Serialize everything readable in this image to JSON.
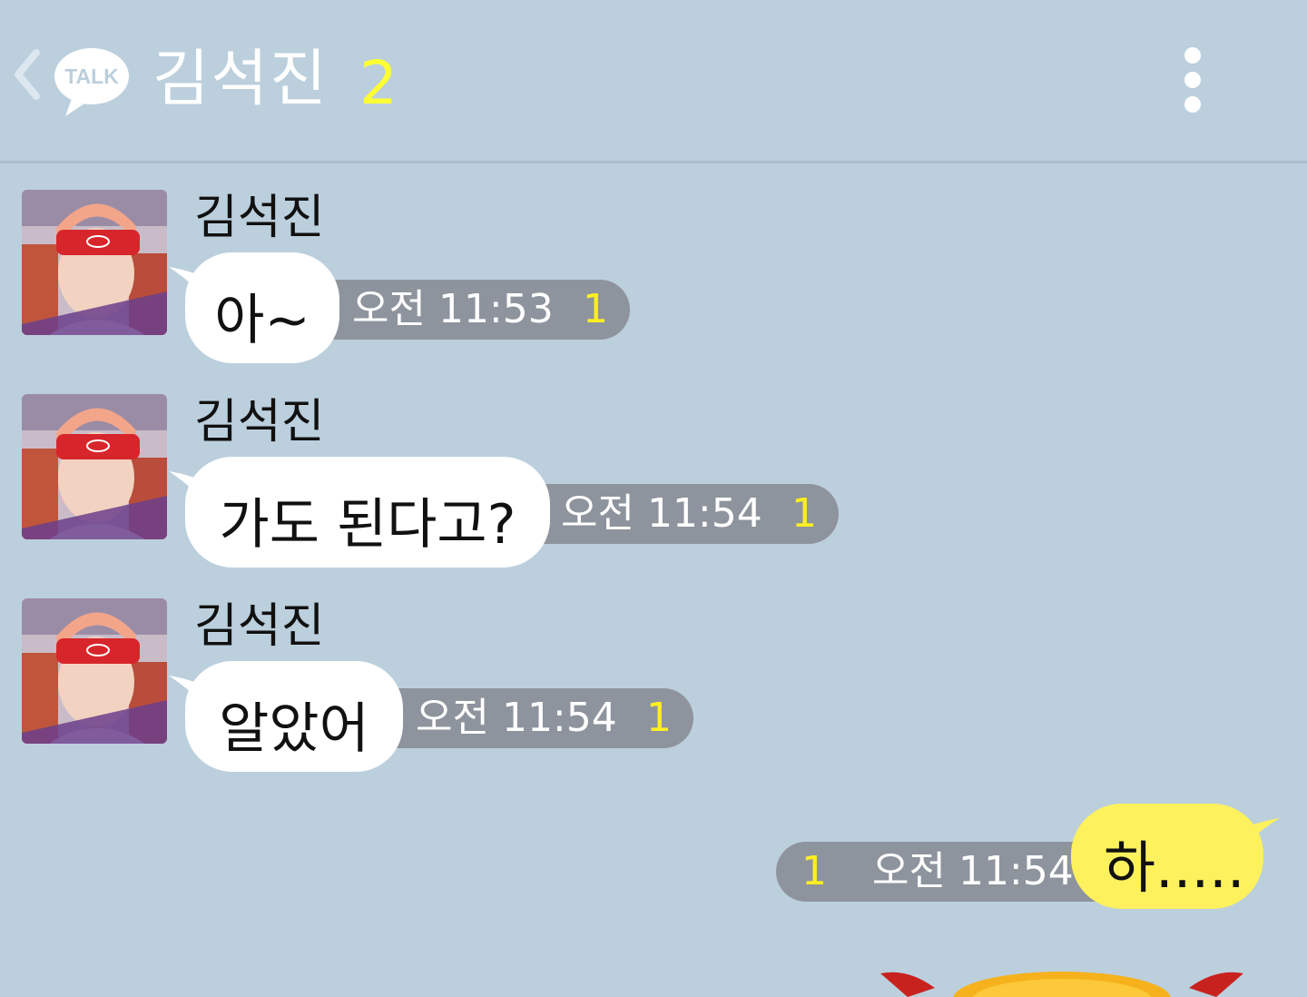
{
  "header": {
    "back_icon": "chevron-left-icon",
    "app_badge_text": "TALK",
    "title": "김석진",
    "member_count": "2",
    "menu_icon": "more-vertical-icon"
  },
  "messages": [
    {
      "sender": "김석진",
      "avatar": "profile-photo",
      "text": "아~",
      "time": "오전 11:53",
      "unread": "1"
    },
    {
      "sender": "김석진",
      "avatar": "profile-photo",
      "text": "가도 된다고?",
      "time": "오전 11:54",
      "unread": "1"
    },
    {
      "sender": "김석진",
      "avatar": "profile-photo",
      "text": "알았어",
      "time": "오전 11:54",
      "unread": "1"
    }
  ],
  "my_message": {
    "text": "하.....",
    "time": "오전 11:54",
    "unread": "1"
  },
  "colors": {
    "background": "#bccfdd",
    "my_bubble": "#fdf15e",
    "other_bubble": "#ffffff",
    "meta_pill": "#8e949d",
    "unread": "#ffee22",
    "member_count": "#ffff33"
  }
}
